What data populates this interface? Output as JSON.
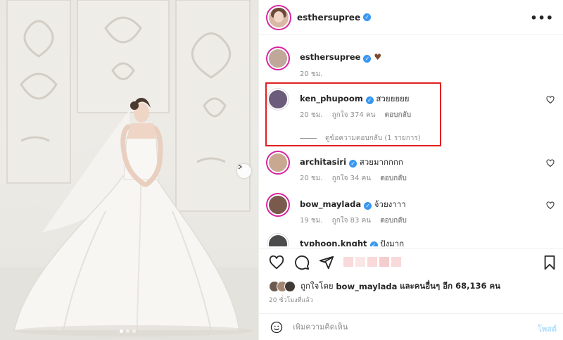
{
  "post": {
    "author": "esthersupree",
    "more_label": "•••"
  },
  "caption": {
    "username": "esthersupree",
    "emoji": "♥",
    "time": "20 ชม."
  },
  "comments": [
    {
      "username": "ken_phupoom",
      "text": "สวยยยยย",
      "time": "20 ชม.",
      "likes": "ถูกใจ 374 คน",
      "reply": "ตอบกลับ",
      "view_replies": "ดูข้อความตอบกลับ (1 รายการ)"
    },
    {
      "username": "architasiri",
      "text": "สวยมากกกก",
      "time": "20 ชม.",
      "likes": "ถูกใจ 34 คน",
      "reply": "ตอบกลับ"
    },
    {
      "username": "bow_maylada",
      "text": "จ้วยงาาา",
      "time": "19 ชม.",
      "likes": "ถูกใจ 83 คน",
      "reply": "ตอบกลับ"
    },
    {
      "username": "typhoon.knght",
      "text": "ปังมาก"
    }
  ],
  "likes_summary": {
    "prefix": "ถูกใจโดย",
    "user": "bow_maylada",
    "suffix": "และคนอื่นๆ อีก 68,136 คน"
  },
  "timestamp": "20 ชั่วโมงที่แล้ว",
  "add_comment": {
    "placeholder": "เพิ่มความคิดเห็น",
    "post_label": "โพสต์"
  },
  "colors": {
    "highlight": "#e02020",
    "verified": "#3897f0",
    "story_ring": "#d6249f"
  }
}
